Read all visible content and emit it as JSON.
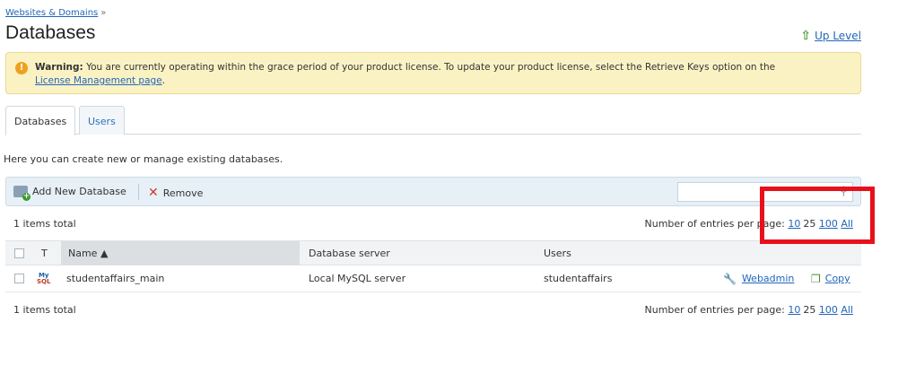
{
  "breadcrumb": {
    "parent": "Websites & Domains",
    "separator": "»"
  },
  "page_title": "Databases",
  "up_level": "Up Level",
  "warning": {
    "label": "Warning:",
    "text": "You are currently operating within the grace period of your product license. To update your product license, select the Retrieve Keys option on the",
    "link": "License Management page",
    "end": "."
  },
  "tabs": [
    {
      "label": "Databases",
      "active": true
    },
    {
      "label": "Users",
      "active": false
    }
  ],
  "intro": "Here you can create new or manage existing databases.",
  "toolbar": {
    "add_label": "Add New Database",
    "remove_label": "Remove",
    "search_value": ""
  },
  "items_total": "1 items total",
  "per_page": {
    "label": "Number of entries per page:",
    "options": [
      "10",
      "25",
      "100",
      "All"
    ],
    "selected": "25"
  },
  "table": {
    "headers": {
      "type": "T",
      "name": "Name ▲",
      "server": "Database server",
      "users": "Users"
    },
    "rows": [
      {
        "type_icon_top": "My",
        "type_icon_bottom": "SQL",
        "name": "studentaffairs_main",
        "server": "Local MySQL server",
        "users": "studentaffairs",
        "action_webadmin": "Webadmin",
        "action_copy": "Copy"
      }
    ]
  },
  "colors": {
    "link": "#2266bb",
    "warning_bg": "#fbf2c4",
    "toolbar_bg": "#e7f0f7",
    "highlight": "#e8101a"
  }
}
